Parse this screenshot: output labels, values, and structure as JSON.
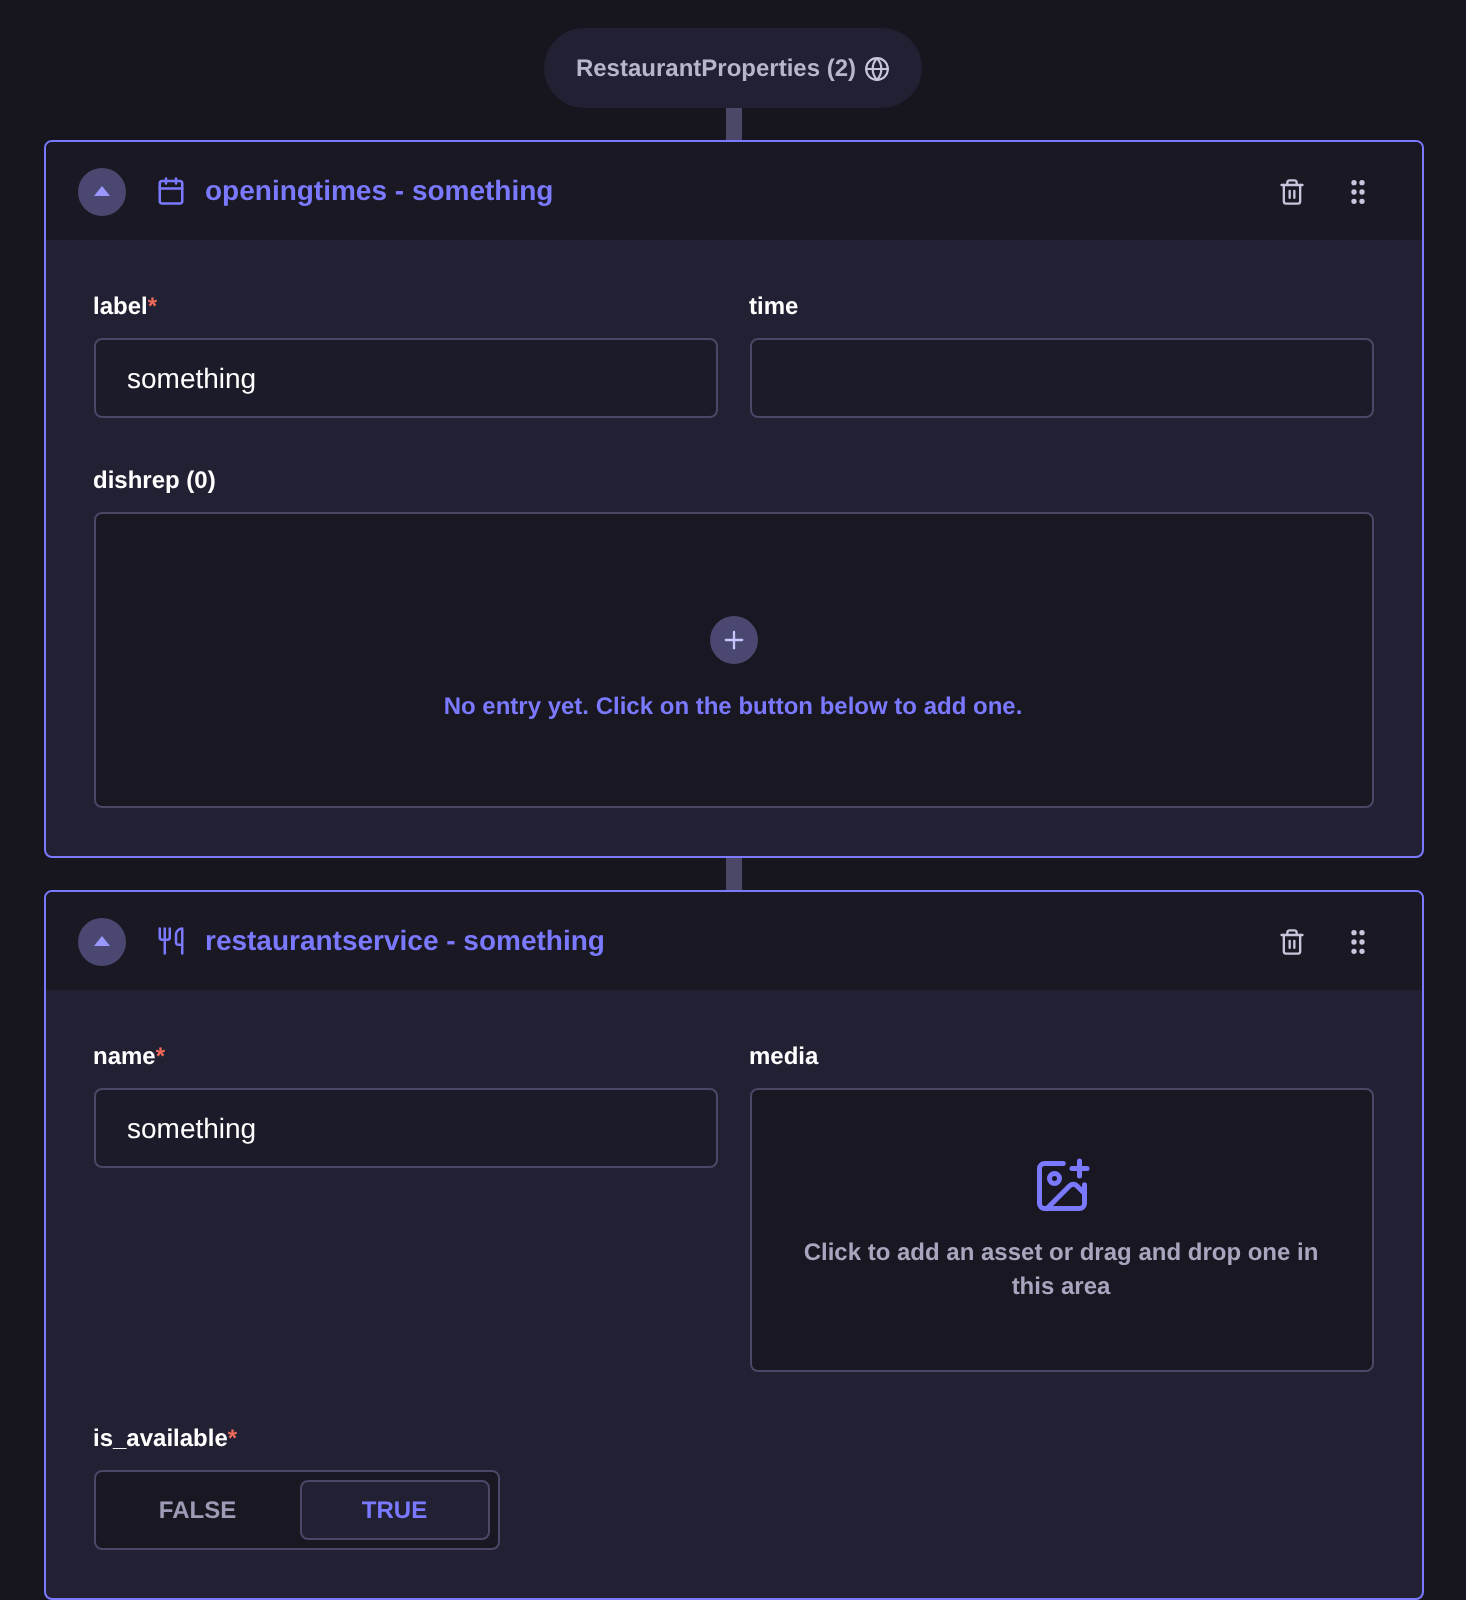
{
  "root_node": {
    "label": "RestaurantProperties (2)"
  },
  "cards": [
    {
      "title": "openingtimes - something",
      "expanded": true,
      "rows": [
        [
          {
            "kind": "text",
            "label": "label",
            "required_mark": "*",
            "value": "something"
          },
          {
            "kind": "text",
            "label": "time"
          }
        ],
        [
          {
            "kind": "list",
            "label": "dishrep (0)",
            "empty_text": "No entry yet. Click on the button below to add one."
          }
        ]
      ]
    },
    {
      "title": "restaurantservice - something",
      "expanded": true,
      "rows": [
        [
          {
            "kind": "text",
            "label": "name",
            "required_mark": "*",
            "value": "something"
          },
          {
            "kind": "media",
            "label": "media",
            "hint": "Click to add an asset or drag and drop one in this area"
          }
        ],
        [
          {
            "kind": "boolean",
            "label": "is_available",
            "required_mark": "*",
            "options": [
              {
                "label": "FALSE",
                "selected": false
              },
              {
                "label": "TRUE",
                "selected": true
              }
            ]
          }
        ]
      ]
    }
  ]
}
